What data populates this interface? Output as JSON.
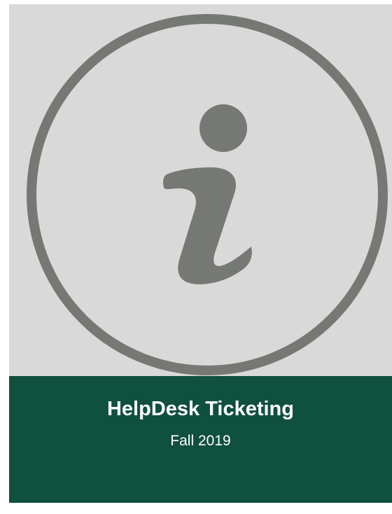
{
  "cover": {
    "icon": "info-icon",
    "title": "HelpDesk Ticketing",
    "subtitle": "Fall 2019"
  },
  "colors": {
    "hero_background": "#d9d9d9",
    "icon_gray": "#767874",
    "banner_background": "#10503f",
    "text": "#ffffff"
  }
}
